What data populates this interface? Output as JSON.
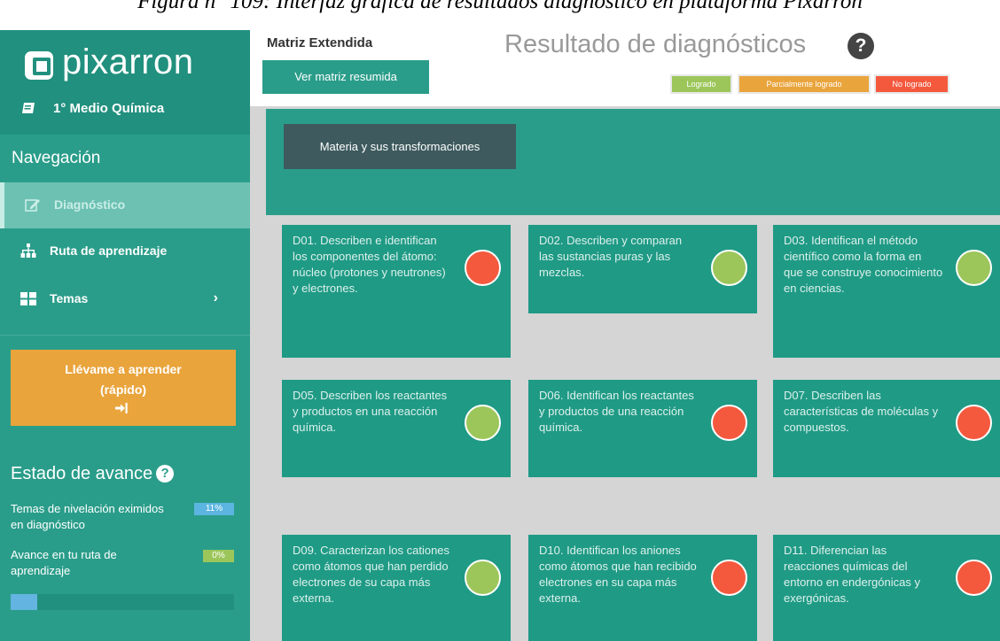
{
  "caption": "Figura n° 109: Interfaz gráfica de resultados diagnóstico en plataforma Pixarron",
  "colors": {
    "teal": "#2a9d8a",
    "teal_dark": "#21907e",
    "orange": "#e9a43c",
    "red": "#f4593e",
    "green": "#9cc65a"
  },
  "sidebar": {
    "brand": "pixarron",
    "course": "1° Medio Química",
    "nav_title": "Navegación",
    "items": [
      {
        "label": "Diagnóstico",
        "icon": "edit-icon",
        "active": true
      },
      {
        "label": "Ruta de aprendizaje",
        "icon": "sitemap-icon"
      },
      {
        "label": "Temas",
        "icon": "grid-icon",
        "chevron": "›"
      }
    ],
    "cta_line1": "Llévame a aprender",
    "cta_line2": "(rápido)",
    "progress_title": "Estado de avance",
    "progress": [
      {
        "label": "Temas de nivelación eximidos en diagnóstico",
        "badge": "11%"
      },
      {
        "label": "Avance en tu ruta de aprendizaje",
        "badge": "0%"
      }
    ],
    "progress_bar_fraction": 0.12
  },
  "main": {
    "matrix_title": "Matriz Extendida",
    "summary_button": "Ver matriz resumida",
    "title": "Resultado de diagnósticos",
    "legend": [
      {
        "label": "Logrado",
        "color": "#9cc65a"
      },
      {
        "label": "Parcialmente logrado",
        "color": "#e9a43c"
      },
      {
        "label": "No logrado",
        "color": "#f4593e"
      }
    ],
    "subject": "Materia y sus transformaciones",
    "cards": [
      {
        "text": "D01. Describen e identifican los componentes del átomo: núcleo (protones y neutrones) y electrones.",
        "status": "No logrado"
      },
      {
        "text": "D02. Describen y comparan las sustancias puras y las mezclas.",
        "status": "Logrado"
      },
      {
        "text": "D03. Identifican el método científico como la forma en que se construye conocimiento en ciencias.",
        "status": "Logrado"
      },
      {
        "text": "D05. Describen los reactantes y productos en una reacción química.",
        "status": "Logrado"
      },
      {
        "text": "D06. Identifican los reactantes y productos de una reacción química.",
        "status": "No logrado"
      },
      {
        "text": "D07. Describen las características de moléculas y compuestos.",
        "status": "No logrado"
      },
      {
        "text": "D09. Caracterizan los cationes como átomos que han perdido electrones de su capa más externa.",
        "status": "Logrado"
      },
      {
        "text": "D10. Identifican los aniones como átomos que han recibido electrones en su capa más externa.",
        "status": "No logrado"
      },
      {
        "text": "D11. Diferencian las reacciones químicas del entorno en endergónicas y exergónicas.",
        "status": "No logrado"
      }
    ]
  }
}
